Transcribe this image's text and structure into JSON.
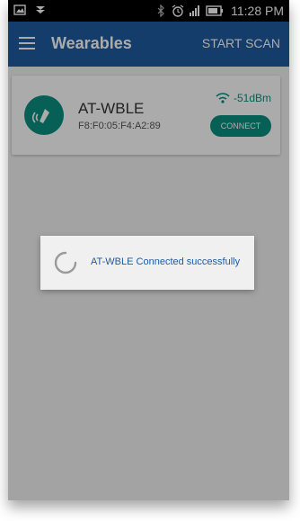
{
  "status_bar": {
    "time": "11:28 PM",
    "icons": [
      "image-icon",
      "download-icon",
      "bluetooth-icon",
      "alarm-icon",
      "signal-icon",
      "battery-icon"
    ]
  },
  "app_bar": {
    "title": "Wearables",
    "action_label": "START SCAN",
    "color": "#1f5ba2"
  },
  "device": {
    "name": "AT-WBLE",
    "mac": "F8:F0:05:F4:A2:89",
    "rssi": "-51dBm",
    "button_label": "CONNECT",
    "accent_color": "#0a8f80",
    "icon": "bluetooth-device-icon"
  },
  "dialog": {
    "message": "AT-WBLE Connected successfully",
    "icon": "spinner-icon"
  }
}
